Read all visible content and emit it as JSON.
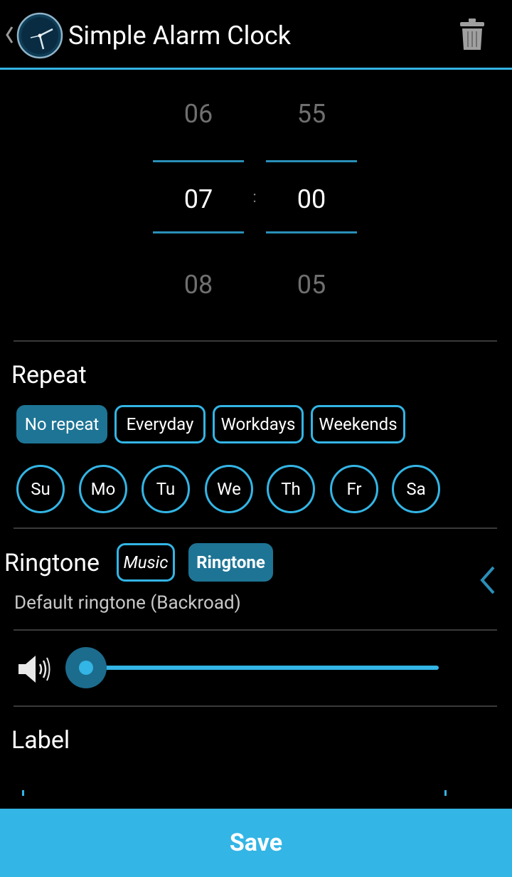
{
  "app": {
    "title": "Simple Alarm Clock",
    "icons": {
      "back": "chevron-left-icon",
      "app": "clock-icon",
      "delete": "trash-icon"
    }
  },
  "time_picker": {
    "hours": {
      "prev": "06",
      "current": "07",
      "next": "08"
    },
    "separator": ":",
    "minutes": {
      "prev": "55",
      "current": "00",
      "next": "05"
    }
  },
  "repeat": {
    "title": "Repeat",
    "presets": [
      {
        "label": "No repeat",
        "active": true
      },
      {
        "label": "Everyday",
        "active": false
      },
      {
        "label": "Workdays",
        "active": false
      },
      {
        "label": "Weekends",
        "active": false
      }
    ],
    "days": [
      "Su",
      "Mo",
      "Tu",
      "We",
      "Th",
      "Fr",
      "Sa"
    ]
  },
  "ringtone": {
    "title": "Ringtone",
    "sources": [
      {
        "label": "Music",
        "active": false
      },
      {
        "label": "Ringtone",
        "active": true
      }
    ],
    "selected": "Default ringtone (Backroad)"
  },
  "volume": {
    "level": 0,
    "icon": "speaker-icon"
  },
  "label": {
    "title": "Label",
    "value": ""
  },
  "save_label": "Save",
  "colors": {
    "accent": "#33b5e5",
    "active_chip": "#1e7495",
    "background": "#000000"
  }
}
